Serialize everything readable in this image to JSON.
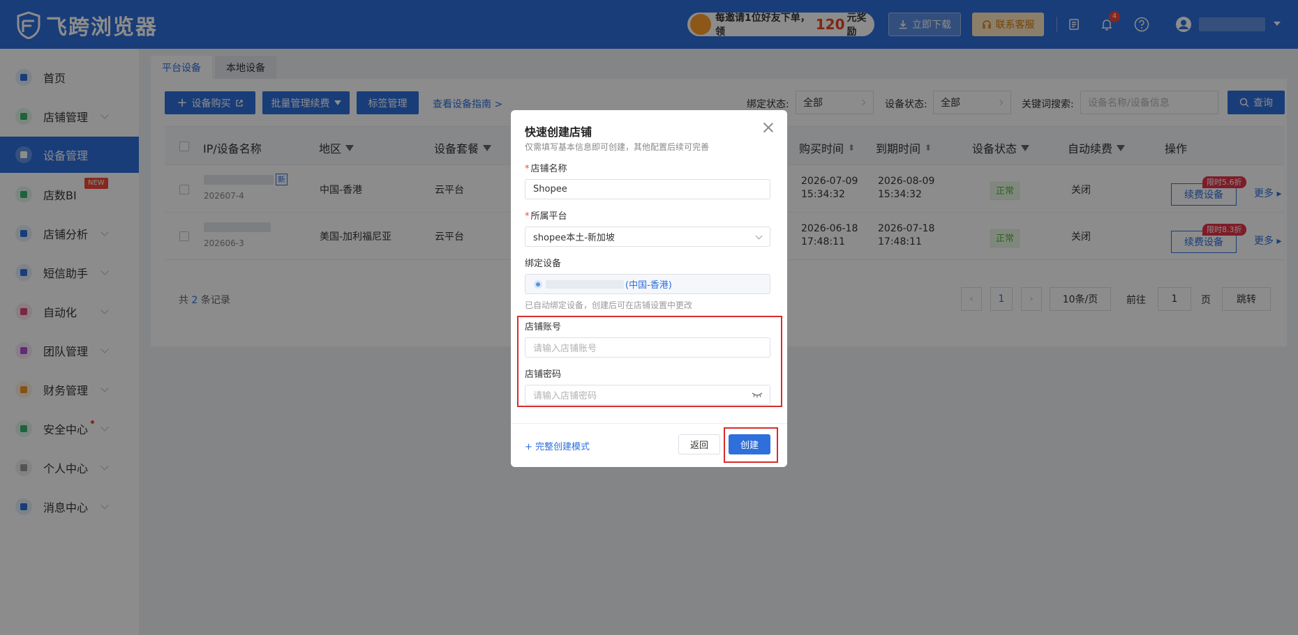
{
  "header": {
    "logo_text": "飞跨浏览器",
    "promo_prefix": "每邀请1位好友下单，领",
    "promo_amount": "120",
    "promo_suffix": "元奖励",
    "download_label": "立即下载",
    "service_label": "联系客服",
    "notification_count": "4"
  },
  "sidebar": {
    "items": [
      {
        "label": "首页"
      },
      {
        "label": "店铺管理"
      },
      {
        "label": "设备管理"
      },
      {
        "label": "店数BI",
        "badge": "NEW"
      },
      {
        "label": "店铺分析"
      },
      {
        "label": "短信助手"
      },
      {
        "label": "自动化"
      },
      {
        "label": "团队管理"
      },
      {
        "label": "财务管理"
      },
      {
        "label": "安全中心"
      },
      {
        "label": "个人中心"
      },
      {
        "label": "消息中心"
      }
    ]
  },
  "tabs": [
    "平台设备",
    "本地设备"
  ],
  "toolbar": {
    "buy_label": "设备购买",
    "batch_label": "批量管理续费",
    "tag_label": "标签管理",
    "guide_label": "查看设备指南 >",
    "bind_label": "绑定状态:",
    "bind_value": "全部",
    "status_label": "设备状态:",
    "status_value": "全部",
    "keyword_label": "关键词搜索:",
    "keyword_placeholder": "设备名称/设备信息",
    "query_label": "查询"
  },
  "table": {
    "columns": [
      "IP/设备名称",
      "地区",
      "设备套餐",
      "购买时间",
      "到期时间",
      "设备状态",
      "自动续费",
      "操作"
    ],
    "rows": [
      {
        "name_sub": "202607-4",
        "new_tag": "新",
        "region": "中国-香港",
        "plan": "云平台",
        "buy_date": "2026-07-09",
        "buy_time": "15:34:32",
        "exp_date": "2026-08-09",
        "exp_time": "15:34:32",
        "status": "正常",
        "auto": "关闭",
        "renew": "续费设备",
        "discount": "限时5.6折",
        "more": "更多"
      },
      {
        "name_sub": "202606-3",
        "region": "美国-加利福尼亚",
        "plan": "云平台",
        "buy_date": "2026-06-18",
        "buy_time": "17:48:11",
        "exp_date": "2026-07-18",
        "exp_time": "17:48:11",
        "status": "正常",
        "auto": "关闭",
        "renew": "续费设备",
        "discount": "限时8.3折",
        "more": "更多"
      }
    ]
  },
  "footer": {
    "total_prefix": "共",
    "total_count": "2",
    "total_suffix": "条记录",
    "page": "1",
    "page_size": "10条/页",
    "goto_label": "前往",
    "goto_value": "1",
    "page_unit": "页",
    "jump_label": "跳转"
  },
  "modal": {
    "title": "快速创建店铺",
    "subtitle": "仅需填写基本信息即可创建，其他配置后续可完善",
    "store_name_label": "店铺名称",
    "store_name_value": "Shopee",
    "platform_label": "所属平台",
    "platform_value": "shopee本土-新加坡",
    "device_label": "绑定设备",
    "device_region": "(中国-香港)",
    "device_hint": "已自动绑定设备，创建后可在店铺设置中更改",
    "account_label": "店铺账号",
    "account_placeholder": "请输入店铺账号",
    "password_label": "店铺密码",
    "password_placeholder": "请输入店铺密码",
    "full_mode_label": "+ 完整创建模式",
    "back_label": "返回",
    "create_label": "创建"
  },
  "colors": {
    "primary": "#2f6fdc",
    "highlight": "#d92b2b",
    "status_ok": "#5ab236",
    "discount": "#e5334a"
  }
}
